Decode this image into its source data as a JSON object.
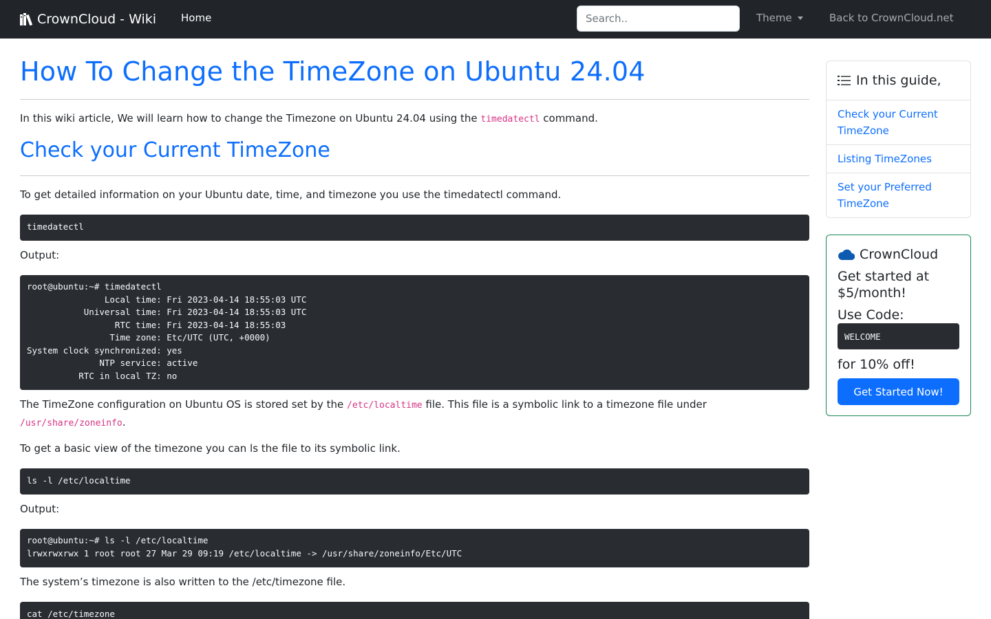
{
  "navbar": {
    "brand": "CrownCloud - Wiki",
    "brand_icon": "books-icon",
    "home": "Home",
    "search_placeholder": "Search..",
    "theme": "Theme",
    "back": "Back to CrownCloud.net"
  },
  "article": {
    "title": "How To Change the TimeZone on Ubuntu 24.04",
    "intro_before": "In this wiki article, We will learn how to change the Timezone on Ubuntu 24.04 using the ",
    "intro_code": "timedatectl",
    "intro_after": " command.",
    "section1_title": "Check your Current TimeZone",
    "p1": "To get detailed information on your Ubuntu date, time, and timezone you use the timedatectl command.",
    "code1": "timedatectl",
    "output_label_1": "Output:",
    "output1": "root@ubuntu:~# timedatectl\n               Local time: Fri 2023-04-14 18:55:03 UTC\n           Universal time: Fri 2023-04-14 18:55:03 UTC\n                 RTC time: Fri 2023-04-14 18:55:03\n                Time zone: Etc/UTC (UTC, +0000)\nSystem clock synchronized: yes\n              NTP service: active\n          RTC in local TZ: no",
    "p2_before": "The TimeZone configuration on Ubuntu OS is stored set by the ",
    "p2_code1": "/etc/localtime",
    "p2_middle": " file. This file is a symbolic link to a timezone file under ",
    "p2_code2": "/usr/share/zoneinfo",
    "p2_after": ".",
    "p3": "To get a basic view of the timezone you can ls the file to its symbolic link.",
    "code2": "ls -l /etc/localtime",
    "output_label_2": "Output:",
    "output2": "root@ubuntu:~# ls -l /etc/localtime\nlrwxrwxrwx 1 root root 27 Mar 29 09:19 /etc/localtime -> /usr/share/zoneinfo/Etc/UTC",
    "p4": "The system’s timezone is also written to the /etc/timezone file.",
    "code3": "cat /etc/timezone"
  },
  "toc": {
    "header": "In this guide,",
    "header_icon": "list-icon",
    "items": [
      {
        "label": "Check your Current TimeZone"
      },
      {
        "label": "Listing TimeZones"
      },
      {
        "label": "Set your Preferred TimeZone"
      }
    ]
  },
  "promo": {
    "brand": "CrownCloud",
    "brand_icon": "cloud-icon",
    "headline": "Get started at $5/month!",
    "code_label": "Use Code:",
    "code": "WELCOME",
    "discount": "for 10% off!",
    "button": "Get Started Now!"
  },
  "colors": {
    "link": "#0d6efd",
    "navbar_bg": "#212529",
    "code_bg": "#292d32",
    "inline_code": "#d63384",
    "promo_border": "#198754"
  }
}
